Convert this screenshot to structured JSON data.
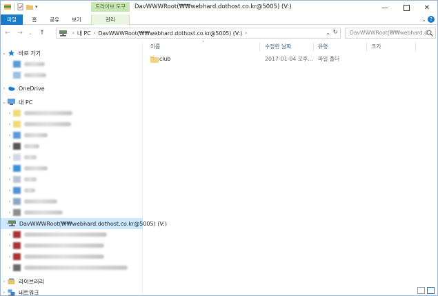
{
  "window": {
    "title": "DavWWWRoot(₩₩webhard.dothost.co.kr@5005) (V:)",
    "context_tab_group": "드라이브 도구"
  },
  "ribbon": {
    "tabs": [
      {
        "label": "파일",
        "kind": "file"
      },
      {
        "label": "홈",
        "kind": "normal"
      },
      {
        "label": "공유",
        "kind": "normal"
      },
      {
        "label": "보기",
        "kind": "normal"
      },
      {
        "label": "관리",
        "kind": "context"
      }
    ]
  },
  "address": {
    "crumbs": [
      "내 PC",
      "DavWWWRoot(₩₩webhard.dothost.co.kr@5005) (V:)"
    ],
    "search_placeholder": "DavWWWRoot(₩₩webhard.d..."
  },
  "navpane": {
    "quick_access": "바로 가기",
    "onedrive": "OneDrive",
    "this_pc": "내 PC",
    "selected_drive": "DavWWWRoot(₩₩webhard.dothost.co.kr@5005) (V:)",
    "libraries": "라이브러리",
    "network": "네트워크"
  },
  "columns": {
    "name": "이름",
    "date": "수정한 날짜",
    "type": "유형",
    "size": "크기"
  },
  "files": [
    {
      "name": "club",
      "date": "2017-01-04 오후...",
      "type": "파일 폴더",
      "size": ""
    }
  ],
  "colors": {
    "accent": "#1979ca",
    "selection": "#cce8ff",
    "context_tab": "#c7e6b4",
    "folder": "#e8c26a"
  },
  "icons": {
    "folder": "folder-icon",
    "drive": "network-drive-icon",
    "star": "star-icon",
    "cloud": "onedrive-icon",
    "pc": "computer-icon"
  }
}
